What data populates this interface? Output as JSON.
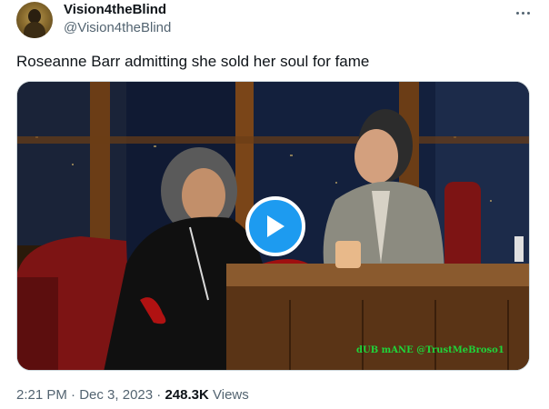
{
  "tweet": {
    "display_name": "Vision4theBlind",
    "handle": "@Vision4theBlind",
    "text": "Roseanne Barr admitting she sold her soul for fame",
    "more_icon": "more-horizontal-icon",
    "avatar_icon": "avatar-image"
  },
  "media": {
    "type": "video",
    "play_icon": "play-icon",
    "watermark": "dUB mANE @TrustMeBroso1",
    "accent_color": "#1d9bf0"
  },
  "meta": {
    "time": "2:21 PM",
    "separator": " · ",
    "date": "Dec 3, 2023",
    "views_count": "248.3K",
    "views_label": "Views"
  }
}
